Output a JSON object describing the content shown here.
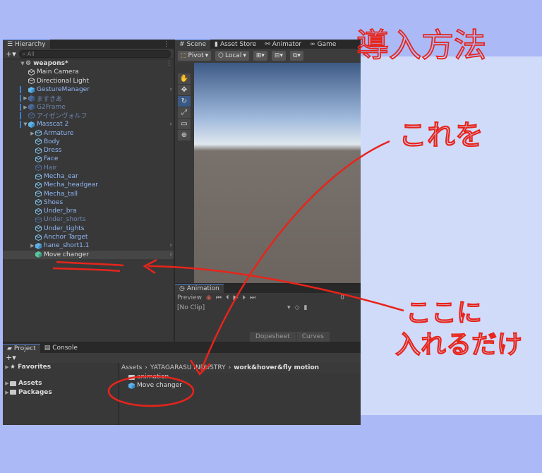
{
  "hierarchy": {
    "tab": "Hierarchy",
    "search_placeholder": "All",
    "root": "weapons*",
    "items": [
      {
        "label": "Main Camera",
        "style": "white"
      },
      {
        "label": "Directional Light",
        "style": "white"
      },
      {
        "label": "GestureManager",
        "style": "blue"
      },
      {
        "label": "ますきあ",
        "style": "dim"
      },
      {
        "label": "G2Frame",
        "style": "dim"
      },
      {
        "label": "アイゼンヴォルフ",
        "style": "dim"
      },
      {
        "label": "Masscat 2",
        "style": "blue"
      },
      {
        "label": "Armature",
        "style": "blue"
      },
      {
        "label": "Body",
        "style": "blue"
      },
      {
        "label": "Dress",
        "style": "blue"
      },
      {
        "label": "Face",
        "style": "blue"
      },
      {
        "label": "Hair",
        "style": "dim"
      },
      {
        "label": "Mecha_ear",
        "style": "blue"
      },
      {
        "label": "Mecha_headgear",
        "style": "blue"
      },
      {
        "label": "Mecha_tall",
        "style": "blue"
      },
      {
        "label": "Shoes",
        "style": "blue"
      },
      {
        "label": "Under_bra",
        "style": "blue"
      },
      {
        "label": "Under_shorts",
        "style": "dim"
      },
      {
        "label": "Under_tights",
        "style": "blue"
      },
      {
        "label": "Anchor Target",
        "style": "blue"
      },
      {
        "label": "hane_short1.1",
        "style": "blue"
      },
      {
        "label": "Move changer",
        "style": "white"
      }
    ]
  },
  "scene": {
    "tabs": [
      "Scene",
      "Asset Store",
      "Animator",
      "Game"
    ],
    "pivot": "Pivot",
    "local": "Local"
  },
  "animation": {
    "tab": "Animation",
    "preview": "Preview",
    "frame": "0",
    "clip": "[No Clip]",
    "dopesheet": "Dopesheet",
    "curves": "Curves"
  },
  "project": {
    "tabs": [
      "Project",
      "Console"
    ],
    "favorites": "Favorites",
    "assets": "Assets",
    "packages": "Packages",
    "breadcrumb": [
      "Assets",
      "YATAGARASU INDUSTRY",
      "work&hover&fly motion"
    ],
    "files": [
      "animation",
      "Move changer"
    ]
  },
  "annotations": {
    "title": "導入方法",
    "this": "これを",
    "here1": "ここに",
    "here2": "入れるだけ",
    "ink": "#e8241b"
  }
}
